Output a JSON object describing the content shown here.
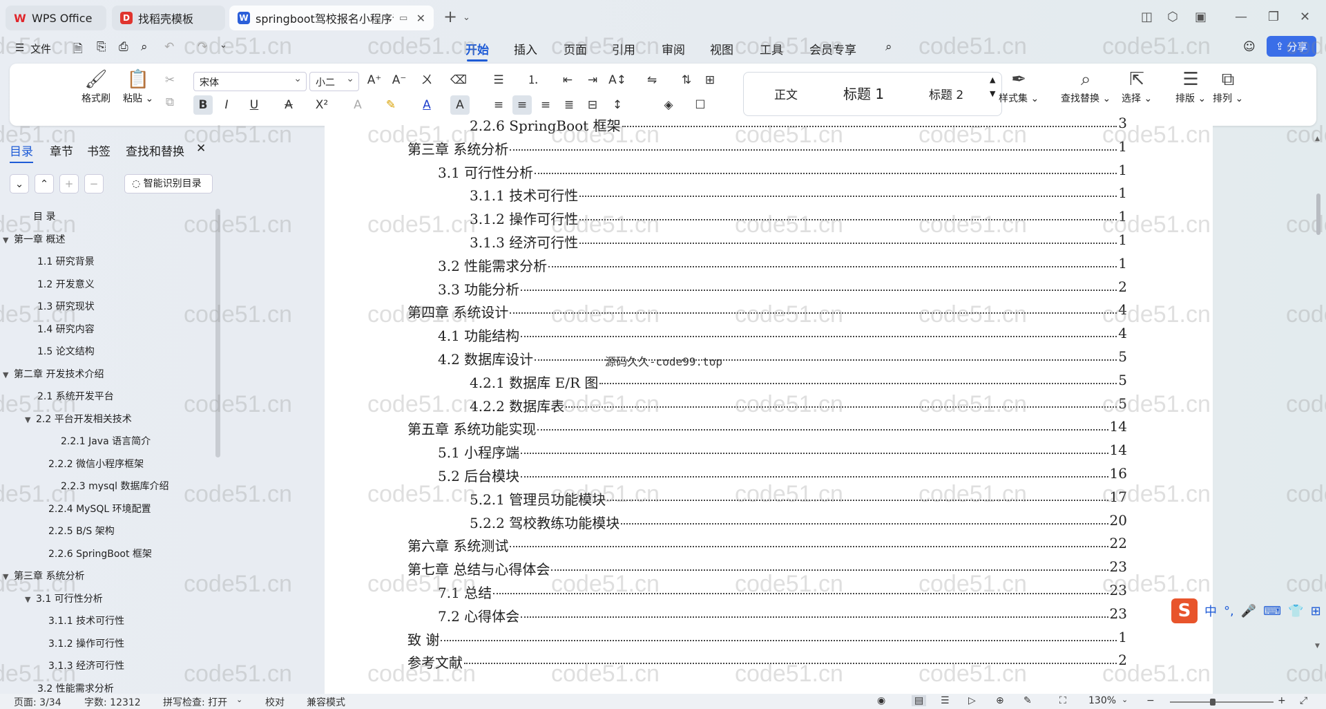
{
  "titlebar": {
    "tabs": [
      {
        "label": "WPS Office",
        "icon": "wps-logo-icon"
      },
      {
        "label": "找稻壳模板",
        "icon": "docer-icon"
      },
      {
        "label": "springboot驾校报名小程序论",
        "icon": "word-doc-icon"
      }
    ],
    "add_tab": "+",
    "window_controls": [
      "minimize",
      "restore",
      "close"
    ]
  },
  "menubar": {
    "file_label": "文件",
    "items": [
      "开始",
      "插入",
      "页面",
      "引用",
      "审阅",
      "视图",
      "工具",
      "会员专享"
    ],
    "active": "开始",
    "share_label": "分享"
  },
  "ribbon": {
    "format_painter": "格式刷",
    "paste": "粘贴",
    "font_name": "宋体",
    "font_size": "小二",
    "styles": [
      "正文",
      "标题 1",
      "标题 2"
    ],
    "style_set": "样式集",
    "find_replace": "查找替换",
    "select": "选择",
    "layout": "排版",
    "arrange": "排列"
  },
  "panel": {
    "tabs": [
      "目录",
      "章节",
      "书签",
      "查找和替换"
    ],
    "active_tab": "目录",
    "smart_button": "智能识别目录",
    "toc": [
      {
        "label": "目  录",
        "level": 0,
        "arrow": ""
      },
      {
        "label": "第一章  概述",
        "level": 0,
        "arrow": "▼"
      },
      {
        "label": "1.1  研究背景",
        "level": 1,
        "arrow": ""
      },
      {
        "label": "1.2  开发意义",
        "level": 1,
        "arrow": ""
      },
      {
        "label": "1.3  研究现状",
        "level": 1,
        "arrow": ""
      },
      {
        "label": "1.4  研究内容",
        "level": 1,
        "arrow": ""
      },
      {
        "label": "1.5  论文结构",
        "level": 1,
        "arrow": ""
      },
      {
        "label": "第二章  开发技术介绍",
        "level": 0,
        "arrow": "▼"
      },
      {
        "label": "2.1  系统开发平台",
        "level": 1,
        "arrow": ""
      },
      {
        "label": "2.2  平台开发相关技术",
        "level": 1,
        "arrow": "▼"
      },
      {
        "label": "2.2.1   Java 语言简介",
        "level": 3,
        "arrow": ""
      },
      {
        "label": "2.2.2   微信小程序框架",
        "level": 2,
        "arrow": ""
      },
      {
        "label": "2.2.3   mysql 数据库介绍",
        "level": 3,
        "arrow": ""
      },
      {
        "label": "2.2.4   MySQL 环境配置",
        "level": 2,
        "arrow": ""
      },
      {
        "label": "2.2.5   B/S 架构",
        "level": 2,
        "arrow": ""
      },
      {
        "label": "2.2.6   SpringBoot 框架",
        "level": 2,
        "arrow": ""
      },
      {
        "label": "第三章  系统分析",
        "level": 0,
        "arrow": "▼"
      },
      {
        "label": "3.1  可行性分析",
        "level": 1,
        "arrow": "▼"
      },
      {
        "label": "3.1.1  技术可行性",
        "level": 2,
        "arrow": ""
      },
      {
        "label": "3.1.2  操作可行性",
        "level": 2,
        "arrow": ""
      },
      {
        "label": "3.1.3  经济可行性",
        "level": 2,
        "arrow": ""
      },
      {
        "label": "3.2 性能需求分析",
        "level": 1,
        "arrow": ""
      }
    ]
  },
  "document": {
    "toc_lines": [
      {
        "text": "2.2.6   SpringBoot 框架",
        "page": "3",
        "indent": 2
      },
      {
        "text": "第三章  系统分析",
        "page": "1",
        "indent": 0
      },
      {
        "text": "3.1  可行性分析",
        "page": "1",
        "indent": 1
      },
      {
        "text": "3.1.1  技术可行性",
        "page": "1",
        "indent": 2
      },
      {
        "text": "3.1.2  操作可行性",
        "page": "1",
        "indent": 2
      },
      {
        "text": "3.1.3  经济可行性",
        "page": "1",
        "indent": 2
      },
      {
        "text": "3.2 性能需求分析",
        "page": "1",
        "indent": 1
      },
      {
        "text": "3.3 功能分析",
        "page": "2",
        "indent": 1
      },
      {
        "text": "第四章  系统设计",
        "page": "4",
        "indent": 0
      },
      {
        "text": "4.1 功能结构",
        "page": "4",
        "indent": 1
      },
      {
        "text": "4.2  数据库设计",
        "page": "5",
        "indent": 1
      },
      {
        "text": "4.2.1  数据库 E/R 图",
        "page": "5",
        "indent": 2
      },
      {
        "text": "4.2.2  数据库表",
        "page": "5",
        "indent": 2
      },
      {
        "text": "第五章  系统功能实现",
        "page": "14",
        "indent": 0
      },
      {
        "text": "5.1 小程序端",
        "page": "14",
        "indent": 1
      },
      {
        "text": "5.2 后台模块",
        "page": "16",
        "indent": 1
      },
      {
        "text": "5.2.1 管理员功能模块",
        "page": "17",
        "indent": 2
      },
      {
        "text": "5.2.2 驾校教练功能模块",
        "page": "20",
        "indent": 2
      },
      {
        "text": "第六章  系统测试",
        "page": "22",
        "indent": 0
      },
      {
        "text": "第七章 总结与心得体会",
        "page": "23",
        "indent": 0
      },
      {
        "text": "7.1  总结",
        "page": "23",
        "indent": 1
      },
      {
        "text": "7.2  心得体会",
        "page": "23",
        "indent": 1
      },
      {
        "text": "致    谢",
        "page": "1",
        "indent": 0
      },
      {
        "text": "参考文献",
        "page": "2",
        "indent": 0
      }
    ],
    "overlay_text": "源码久久-code99.top"
  },
  "watermark": "code51.cn",
  "ime": {
    "lang": "中",
    "punct": "°,"
  },
  "statusbar": {
    "page": "页面: 3/34",
    "words": "字数: 12312",
    "spell": "拼写检查: 打开",
    "proof": "校对",
    "compat": "兼容模式",
    "zoom": "130%",
    "zoom_fraction": 0.4
  },
  "colors": {
    "accent": "#1e5bd6",
    "share_bg": "#3a6ee8",
    "ime_logo": "#e8542b"
  }
}
